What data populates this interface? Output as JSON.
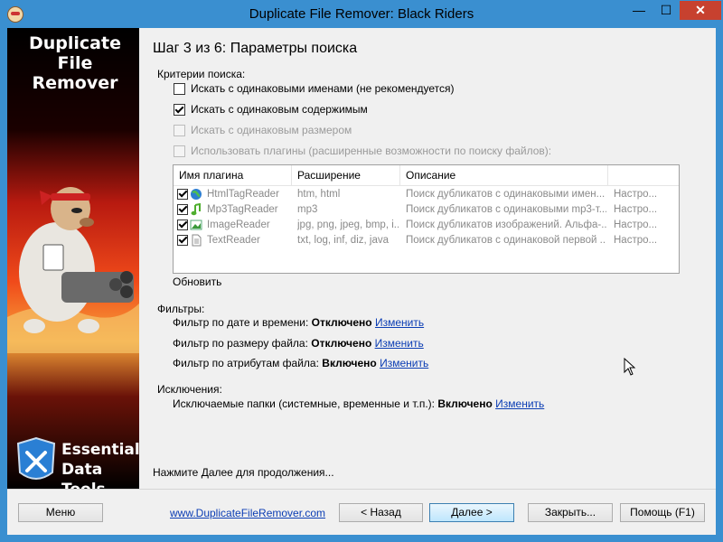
{
  "window": {
    "title": "Duplicate File Remover: Black Riders",
    "minimize_glyph": "—",
    "maximize_glyph": "☐",
    "close_glyph": "✕"
  },
  "sidebar": {
    "logo_top_line1": "Duplicate File",
    "logo_top_line2": "Remover",
    "logo_bottom_line1": "Essential",
    "logo_bottom_line2": "Data Tools"
  },
  "main": {
    "step_title": "Шаг 3 из 6: Параметры поиска",
    "criteria_label": "Критерии поиска:",
    "criteria": [
      {
        "label": "Искать с одинаковыми именами (не рекомендуется)",
        "checked": false,
        "enabled": true
      },
      {
        "label": "Искать с одинаковым содержимым",
        "checked": true,
        "enabled": true
      },
      {
        "label": "Искать с одинаковым размером",
        "checked": false,
        "enabled": false
      },
      {
        "label": "Использовать плагины (расширенные возможности по поиску файлов):",
        "checked": false,
        "enabled": false
      }
    ],
    "plugins_table": {
      "columns": [
        "Имя плагина",
        "Расширение",
        "Описание"
      ],
      "rows": [
        {
          "name": "HtmlTagReader",
          "ext": "htm, html",
          "desc": "Поиск дубликатов с одинаковыми имен...",
          "action": "Настро...",
          "icon": "globe-icon",
          "checked": true
        },
        {
          "name": "Mp3TagReader",
          "ext": "mp3",
          "desc": "Поиск дубликатов с одинаковыми mp3-т...",
          "action": "Настро...",
          "icon": "music-note-icon",
          "checked": true
        },
        {
          "name": "ImageReader",
          "ext": "jpg, png, jpeg, bmp, i...",
          "desc": "Поиск дубликатов изображений. Альфа-...",
          "action": "Настро...",
          "icon": "image-icon",
          "checked": true
        },
        {
          "name": "TextReader",
          "ext": "txt, log, inf, diz, java",
          "desc": "Поиск дубликатов с одинаковой первой ...",
          "action": "Настро...",
          "icon": "text-file-icon",
          "checked": true
        }
      ]
    },
    "refresh_label": "Обновить",
    "filters_label": "Фильтры:",
    "filters": [
      {
        "label": "Фильтр по дате и времени:",
        "status": "Отключено",
        "link": "Изменить"
      },
      {
        "label": "Фильтр по размеру файла:",
        "status": "Отключено",
        "link": "Изменить"
      },
      {
        "label": "Фильтр по атрибутам файла:",
        "status": "Включено",
        "link": "Изменить"
      }
    ],
    "exclusions_label": "Исключения:",
    "exclusion": {
      "label": "Исключаемые папки (системные, временные и т.п.):",
      "status": "Включено",
      "link": "Изменить"
    },
    "hint": "Нажмите Далее для продолжения..."
  },
  "footer": {
    "menu_button": "Меню",
    "website_link": "www.DuplicateFileRemover.com",
    "back_button": "< Назад",
    "next_button": "Далее >",
    "close_button": "Закрыть...",
    "help_button": "Помощь (F1)"
  }
}
